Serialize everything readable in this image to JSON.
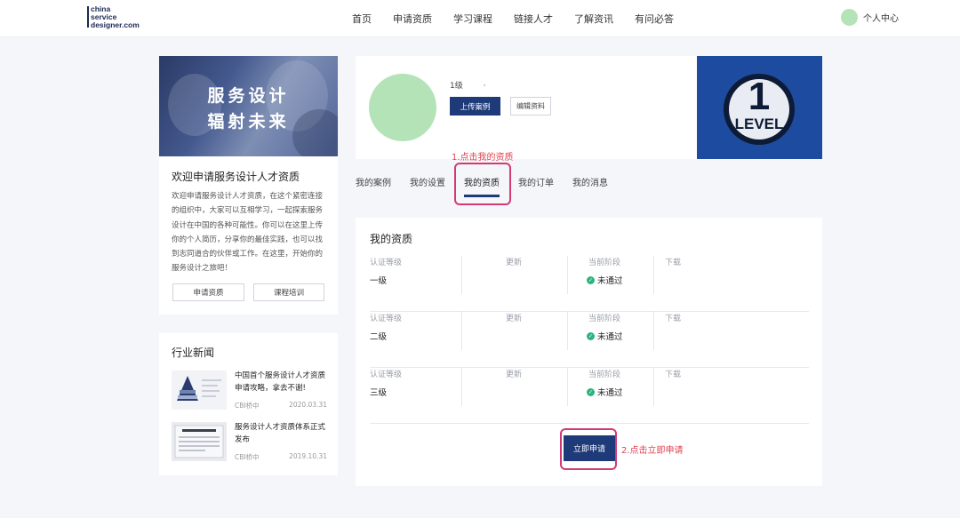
{
  "header": {
    "logo_text": "china\nservice\ndesigner.com",
    "nav": [
      "首页",
      "申请资质",
      "学习课程",
      "链接人才",
      "了解资讯",
      "有问必答"
    ],
    "user_label": "个人中心"
  },
  "intro": {
    "banner_line1": "服务设计",
    "banner_line2": "辐射未来",
    "heading": "欢迎申请服务设计人才资质",
    "body": "欢迎申请服务设计人才资质，在这个紧密连接的组织中，大家可以互相学习，一起探索服务设计在中国的各种可能性。你可以在这里上传你的个人简历，分享你的最佳实践，也可以找到志同道合的伙伴或工作。在这里，开始你的服务设计之旅吧！",
    "btn_apply": "申请资质",
    "btn_course": "课程培训"
  },
  "news": {
    "heading": "行业新闻",
    "items": [
      {
        "title": "中国首个服务设计人才资质申请攻略，拿去不谢!",
        "source": "CBI桥中",
        "date": "2020.03.31"
      },
      {
        "title": "服务设计人才资质体系正式发布",
        "source": "CBI桥中",
        "date": "2019.10.31"
      }
    ]
  },
  "profile": {
    "level_label": "1级",
    "level_dot": "·",
    "upload_btn": "上传案例",
    "edit_btn": "编辑资料",
    "badge_number": "1",
    "badge_text": "LEVEL"
  },
  "annotations": {
    "step1": "1.点击我的资质",
    "step2": "2.点击立即申请"
  },
  "tabs": [
    "我的案例",
    "我的设置",
    "我的资质",
    "我的订单",
    "我的消息"
  ],
  "tabs_active_index": 2,
  "qualifications": {
    "heading": "我的资质",
    "col_level": "认证等级",
    "col_update": "更新",
    "col_stage": "当前阶段",
    "col_download": "下载",
    "rows": [
      {
        "level": "一级",
        "status": "未通过"
      },
      {
        "level": "二级",
        "status": "未通过"
      },
      {
        "level": "三级",
        "status": "未通过"
      }
    ],
    "apply_btn": "立即申请"
  },
  "colors": {
    "primary": "#1e3a78",
    "annotation": "#e0414f",
    "highlight": "#d33a74",
    "status_icon": "#2fb37c",
    "avatar": "#b3e3b7"
  }
}
